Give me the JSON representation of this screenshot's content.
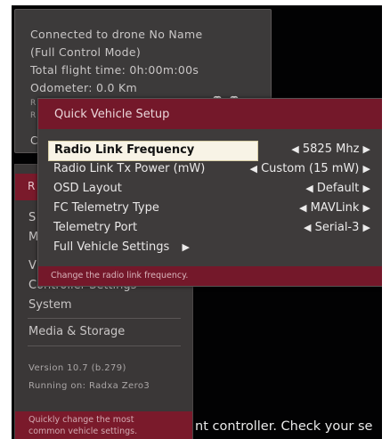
{
  "status": {
    "lines": [
      "Connected to drone No Name",
      "(Full Control Mode)",
      "Total flight time: 0h:00m:00s",
      "Odometer: 0.0 Km"
    ],
    "cut_lines": [
      "R",
      "R"
    ],
    "icon_names": [
      "link-icon",
      "link-icon"
    ]
  },
  "main_menu": {
    "selected_label": "R",
    "items": [
      "S",
      "M",
      "V",
      "Controller Settings",
      "System",
      "Media & Storage"
    ],
    "version": "Version 10.7 (b.279)",
    "running": "Running on: Radxa Zero3",
    "hint_line1": "Quickly change the most",
    "hint_line2": "common vehicle settings.",
    "cut_item": "C"
  },
  "dialog": {
    "title": "Quick Vehicle Setup",
    "rows": [
      {
        "label": "Radio Link Frequency",
        "value": "5825 Mhz"
      },
      {
        "label": "Radio Link Tx Power (mW)",
        "value": "Custom (15 mW)"
      },
      {
        "label": "OSD Layout",
        "value": "Default"
      },
      {
        "label": "FC Telemetry Type",
        "value": "MAVLink"
      },
      {
        "label": "Telemetry Port",
        "value": "Serial-3"
      },
      {
        "label": "Full Vehicle Settings",
        "value": ""
      }
    ],
    "hint": "Change the radio link frequency."
  },
  "bottom_text": "nt controller. Check your se",
  "colors": {
    "background": "#020203",
    "panel": "#3e3b3b",
    "accent": "#74182a",
    "selection": "#f8f3e6"
  }
}
